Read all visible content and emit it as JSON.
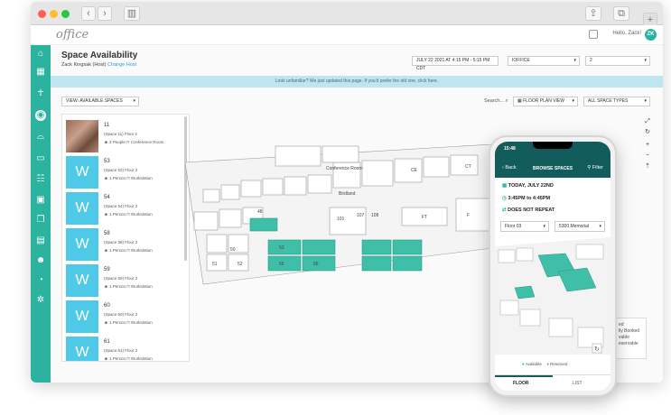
{
  "app": {
    "logo": "office",
    "greeting": "Hello, Zack!",
    "avatar_initials": "ZK",
    "accent": "#2bb3a0"
  },
  "page": {
    "title": "Space Availability",
    "host_text": "Zack Kingsak (Host)",
    "change_host": "Change Host",
    "date_range": "JULY 22 2021 AT 4:15 PM - 5:15 PM CDT",
    "building": "IOFFICE",
    "floor": "2",
    "banner": "Look unfamiliar? We just updated this page. If you'd prefer the old one, click here.",
    "view_select": "VIEW: AVAILABLE SPACES",
    "search_label": "Search...",
    "view_mode": "FLOOR PLAN VIEW",
    "space_types": "ALL SPACE TYPES"
  },
  "spaces": [
    {
      "name": "11",
      "sub": "(Space 11) Floor 2",
      "people": "3 People",
      "type": "Conference Room",
      "thumb": ""
    },
    {
      "name": "53",
      "sub": "(Space 53) Floor 2",
      "people": "1 Person",
      "type": "Workstation",
      "thumb": "W"
    },
    {
      "name": "54",
      "sub": "(Space 54) Floor 2",
      "people": "1 Person",
      "type": "Workstation",
      "thumb": "W"
    },
    {
      "name": "58",
      "sub": "(Space 58) Floor 2",
      "people": "1 Person",
      "type": "Workstation",
      "thumb": "W"
    },
    {
      "name": "59",
      "sub": "(Space 59) Floor 2",
      "people": "1 Person",
      "type": "Workstation",
      "thumb": "W"
    },
    {
      "name": "60",
      "sub": "(Space 60) Floor 2",
      "people": "1 Person",
      "type": "Workstation",
      "thumb": "W"
    },
    {
      "name": "61",
      "sub": "(Space 61) Floor 2",
      "people": "1 Person",
      "type": "Workstation",
      "thumb": "W"
    }
  ],
  "map_labels": [
    "48",
    "50",
    "51",
    "52",
    "53",
    "55",
    "56",
    "101",
    "107",
    "108",
    "Conference Room",
    "Birdland",
    "CE",
    "CT",
    "FT",
    "F"
  ],
  "phone": {
    "time": "15:48",
    "back": "Back",
    "header": "BROWSE SPACES",
    "filter": "Filter",
    "date": "TODAY, JULY 22ND",
    "time_range": "3:45PM to 4:45PM",
    "repeat": "DOES NOT REPEAT",
    "floor_select": "Floor 03",
    "building_select": "5300 Memorial",
    "legend_available": "Available",
    "legend_reserved": "Reserved",
    "tab_floor": "FLOOR",
    "tab_list": "LIST"
  },
  "side_card": [
    "ed",
    "lly Booked",
    "vable",
    "eservable"
  ]
}
